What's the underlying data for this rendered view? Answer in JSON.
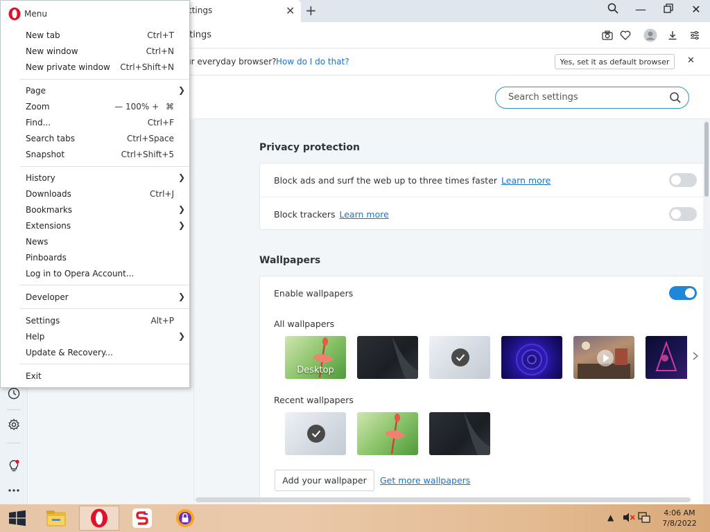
{
  "tab": {
    "title": "ttings",
    "close": "✕"
  },
  "new_tab": "+",
  "window_controls": {
    "search": "search",
    "minimize": "—",
    "restore": "restore",
    "close": "✕"
  },
  "address": {
    "text": "ttings"
  },
  "infobar": {
    "text": "ur everyday browser?",
    "link": "How do I do that?",
    "button": "Yes, set it as default browser",
    "close": "✕"
  },
  "search": {
    "placeholder": "Search settings"
  },
  "menu": {
    "title": "Menu",
    "zoom_value": "100%",
    "zoom_minus": "—",
    "zoom_plus": "+",
    "items": [
      {
        "label": "New tab",
        "shortcut": "Ctrl+T",
        "submenu": false
      },
      {
        "label": "New window",
        "shortcut": "Ctrl+N",
        "submenu": false
      },
      {
        "label": "New private window",
        "shortcut": "Ctrl+Shift+N",
        "submenu": false
      },
      {
        "label": "Page",
        "shortcut": "",
        "submenu": true
      },
      {
        "label": "Zoom",
        "shortcut": "",
        "submenu": false
      },
      {
        "label": "Find...",
        "shortcut": "Ctrl+F",
        "submenu": false
      },
      {
        "label": "Search tabs",
        "shortcut": "Ctrl+Space",
        "submenu": false
      },
      {
        "label": "Snapshot",
        "shortcut": "Ctrl+Shift+5",
        "submenu": false
      },
      {
        "label": "History",
        "shortcut": "",
        "submenu": true
      },
      {
        "label": "Downloads",
        "shortcut": "Ctrl+J",
        "submenu": false
      },
      {
        "label": "Bookmarks",
        "shortcut": "",
        "submenu": true
      },
      {
        "label": "Extensions",
        "shortcut": "",
        "submenu": true
      },
      {
        "label": "News",
        "shortcut": "",
        "submenu": false
      },
      {
        "label": "Pinboards",
        "shortcut": "",
        "submenu": false
      },
      {
        "label": "Log in to Opera Account...",
        "shortcut": "",
        "submenu": false
      },
      {
        "label": "Developer",
        "shortcut": "",
        "submenu": true
      },
      {
        "label": "Settings",
        "shortcut": "Alt+P",
        "submenu": false
      },
      {
        "label": "Help",
        "shortcut": "",
        "submenu": true
      },
      {
        "label": "Update & Recovery...",
        "shortcut": "",
        "submenu": false
      },
      {
        "label": "Exit",
        "shortcut": "",
        "submenu": false
      }
    ]
  },
  "privacy": {
    "title": "Privacy protection",
    "rows": [
      {
        "label": "Block ads and surf the web up to three times faster",
        "link": "Learn more",
        "enabled": false
      },
      {
        "label": "Block trackers",
        "link": "Learn more",
        "enabled": false
      }
    ]
  },
  "wallpapers": {
    "title": "Wallpapers",
    "enable_label": "Enable wallpapers",
    "enabled": true,
    "all_label": "All wallpapers",
    "recent_label": "Recent wallpapers",
    "desktop_caption": "Desktop",
    "add_button": "Add your wallpaper",
    "get_more": "Get more wallpapers"
  },
  "taskbar": {
    "time": "4:06 AM",
    "date": "7/8/2022"
  },
  "colors": {
    "accent": "#1e87d8",
    "link": "#1a73c8",
    "opera_red": "#e0112b"
  }
}
